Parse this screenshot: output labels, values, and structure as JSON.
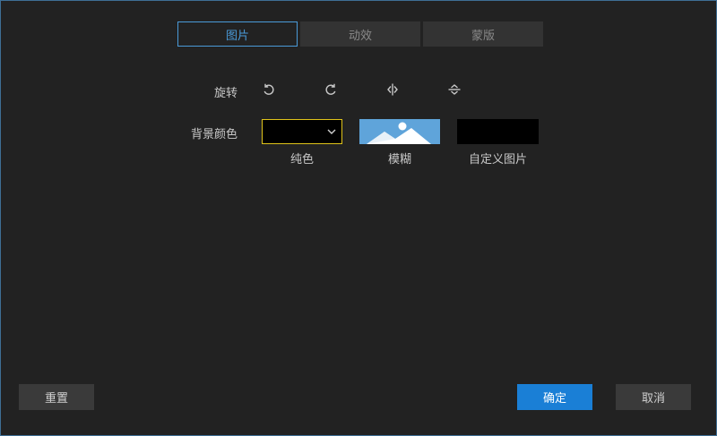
{
  "tabs": [
    {
      "label": "图片",
      "active": true
    },
    {
      "label": "动效",
      "active": false
    },
    {
      "label": "蒙版",
      "active": false
    }
  ],
  "rotate": {
    "label": "旋转",
    "icons": [
      "rotate-left-icon",
      "rotate-right-icon",
      "flip-horizontal-icon",
      "flip-vertical-icon"
    ]
  },
  "background": {
    "label": "背景颜色",
    "options": [
      {
        "label": "纯色",
        "selected_color": "#000000",
        "selected": true
      },
      {
        "label": "模糊",
        "selected": false
      },
      {
        "label": "自定义图片",
        "selected": false
      }
    ]
  },
  "footer": {
    "reset_label": "重置",
    "ok_label": "确定",
    "cancel_label": "取消"
  },
  "colors": {
    "accent": "#1a7fd6",
    "tab_active": "#4a9ad8",
    "selected_border": "#e0c41a"
  }
}
